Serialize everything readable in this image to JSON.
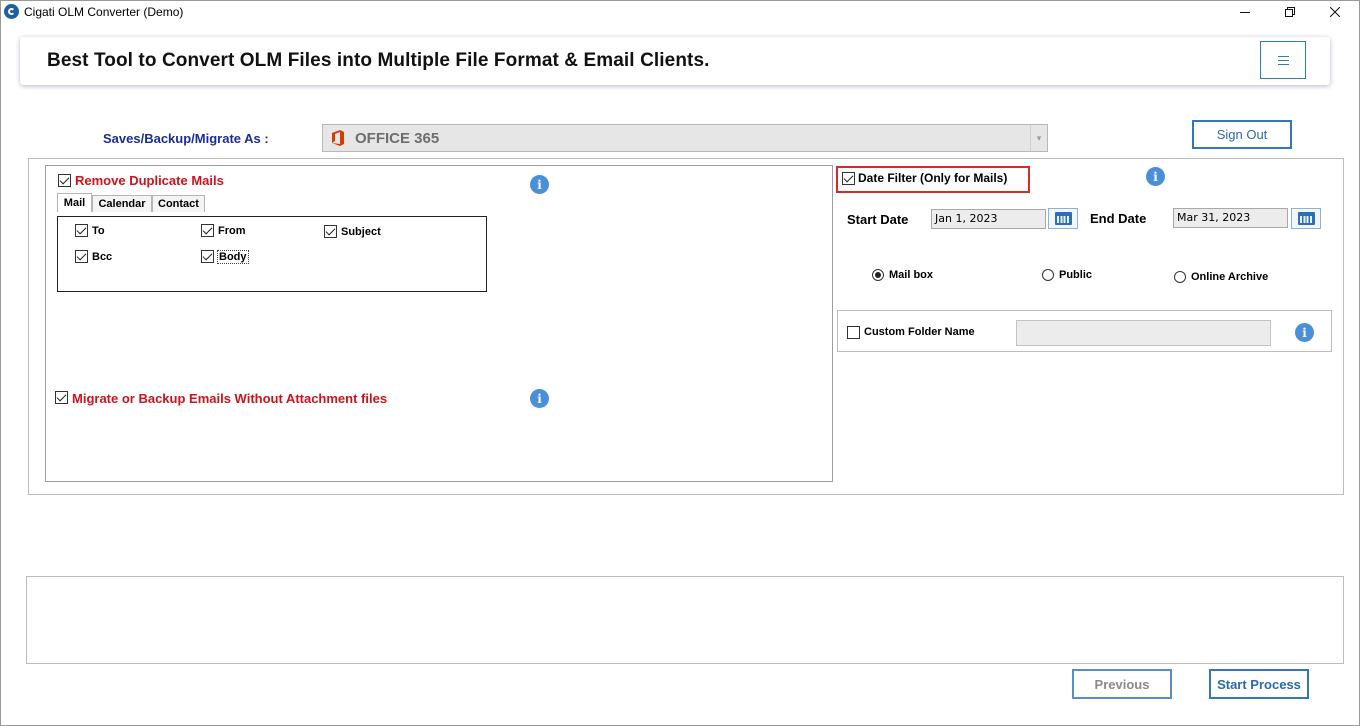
{
  "window": {
    "title": "Cigati OLM Converter (Demo)",
    "minimize_icon": "minimize-icon",
    "maximize_icon": "restore-icon",
    "close_icon": "close-icon"
  },
  "header": {
    "title": "Best Tool to Convert OLM Files into Multiple File Format & Email Clients.",
    "menu_icon": "hamburger-menu-icon"
  },
  "saves": {
    "label": "Saves/Backup/Migrate As :",
    "selected_format": "OFFICE 365",
    "format_icon": "office-365-icon"
  },
  "sign_out_label": "Sign Out",
  "duplicates": {
    "label": "Remove Duplicate Mails",
    "checked": true,
    "tabs": [
      "Mail",
      "Calendar",
      "Contact"
    ],
    "active_tab": "Mail",
    "fields": {
      "to": "To",
      "from": "From",
      "subject": "Subject",
      "bcc": "Bcc",
      "body": "Body"
    }
  },
  "migrate_without_attachments": {
    "label": "Migrate or Backup Emails Without Attachment files",
    "checked": true
  },
  "date_filter": {
    "label": "Date Filter  (Only for Mails)",
    "checked": true,
    "start_label": "Start Date",
    "start_value": "Jan 1, 2023",
    "end_label": "End Date",
    "end_value": "Mar 31, 2023"
  },
  "mailbox_options": {
    "mailbox": "Mail box",
    "public": "Public",
    "online_archive": "Online Archive",
    "selected": "Mail box"
  },
  "custom_folder": {
    "label": "Custom Folder Name",
    "checked": false,
    "value": ""
  },
  "info_icon": "info-icon",
  "info_glyph": "i",
  "footer": {
    "previous_label": "Previous",
    "start_label": "Start Process"
  },
  "colors": {
    "accent_blue": "#3378b5",
    "label_red": "#d0121b",
    "label_navy": "#1d2c9c",
    "highlight_border": "#d42b2b"
  }
}
